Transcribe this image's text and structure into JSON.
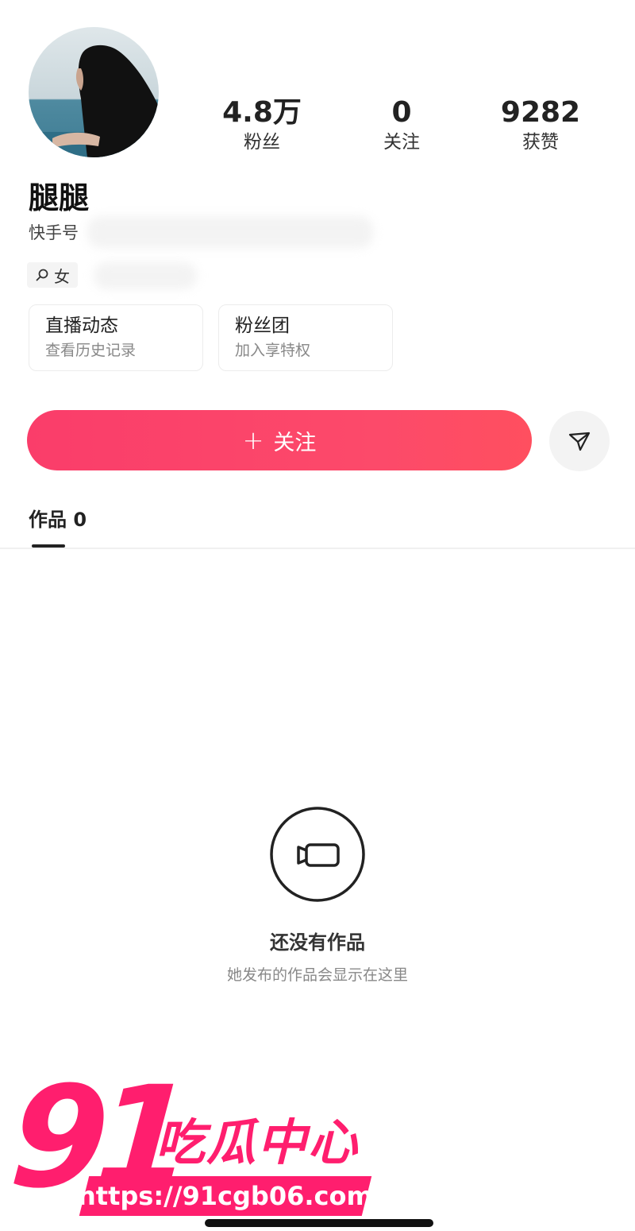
{
  "profile": {
    "nickname": "腿腿",
    "id_label": "快手号",
    "gender": "女",
    "gender_icon": "female-icon"
  },
  "stats": [
    {
      "value": "4.8万",
      "label": "粉丝"
    },
    {
      "value": "0",
      "label": "关注"
    },
    {
      "value": "9282",
      "label": "获赞"
    }
  ],
  "cards": [
    {
      "title": "直播动态",
      "subtitle": "查看历史记录"
    },
    {
      "title": "粉丝团",
      "subtitle": "加入享特权"
    }
  ],
  "actions": {
    "follow_label": "关注",
    "follow_icon": "plus-icon",
    "share_icon": "send-icon",
    "accent": "#fc4a6a"
  },
  "tabs": {
    "works_label": "作品 0"
  },
  "empty_state": {
    "icon": "video-camera-icon",
    "title": "还没有作品",
    "subtitle": "她发布的作品会显示在这里"
  },
  "watermark": {
    "number": "91",
    "title": "吃瓜中心",
    "url": "https://91cgb06.com",
    "color": "#ff1e6e"
  }
}
